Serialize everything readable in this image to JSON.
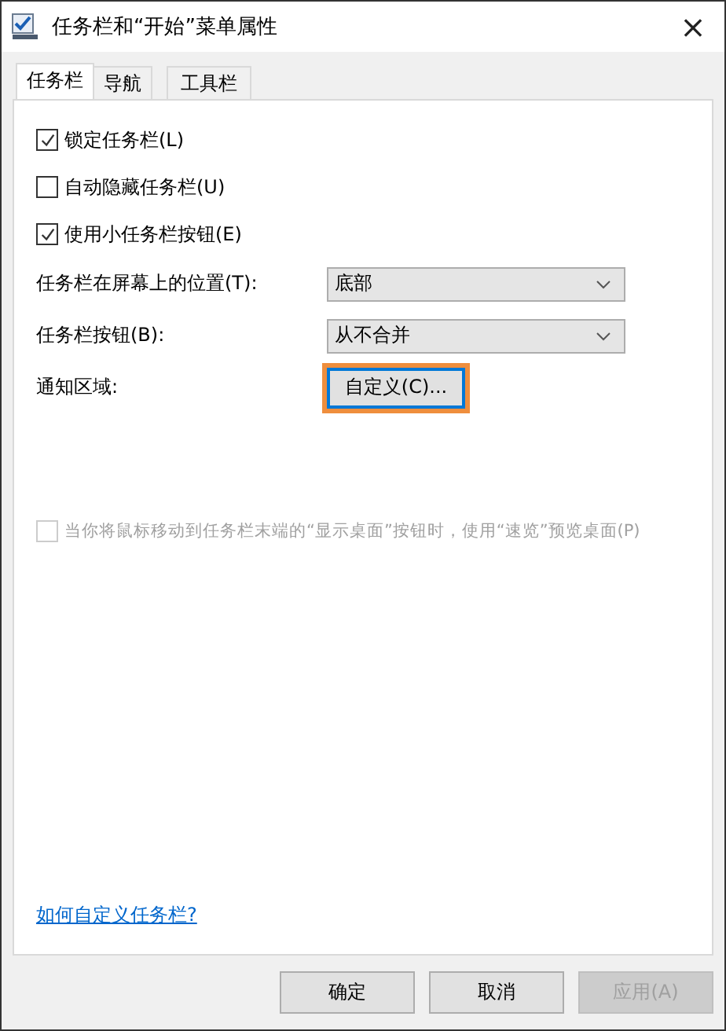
{
  "window": {
    "title": "任务栏和“开始”菜单属性",
    "close": "×"
  },
  "tabs": [
    {
      "label": "任务栏",
      "selected": true
    },
    {
      "label": "导航",
      "selected": false
    },
    {
      "label": "工具栏",
      "selected": false
    }
  ],
  "options": [
    {
      "kind": "checkbox",
      "label": "锁定任务栏(L)",
      "checked": true,
      "disabled": false
    },
    {
      "kind": "checkbox",
      "label": "自动隐藏任务栏(U)",
      "checked": false,
      "disabled": false
    },
    {
      "kind": "checkbox",
      "label": "使用小任务栏按钮(E)",
      "checked": true,
      "disabled": false
    },
    {
      "kind": "dropdown",
      "label": "任务栏在屏幕上的位置(T):",
      "value": "底部"
    },
    {
      "kind": "dropdown",
      "label": "任务栏按钮(B):",
      "value": "从不合并"
    },
    {
      "kind": "button",
      "label": "通知区域:",
      "button": "自定义(C)...",
      "highlighted": true
    },
    {
      "kind": "checkbox",
      "label": "当你将鼠标移动到任务栏末端的“显示桌面”按钮时，使用“速览”预览桌面(P)",
      "checked": false,
      "disabled": true
    }
  ],
  "help_link": "如何自定义任务栏?",
  "buttons": [
    {
      "label": "确定",
      "disabled": false
    },
    {
      "label": "取消",
      "disabled": false
    },
    {
      "label": "应用(A)",
      "disabled": true
    }
  ]
}
